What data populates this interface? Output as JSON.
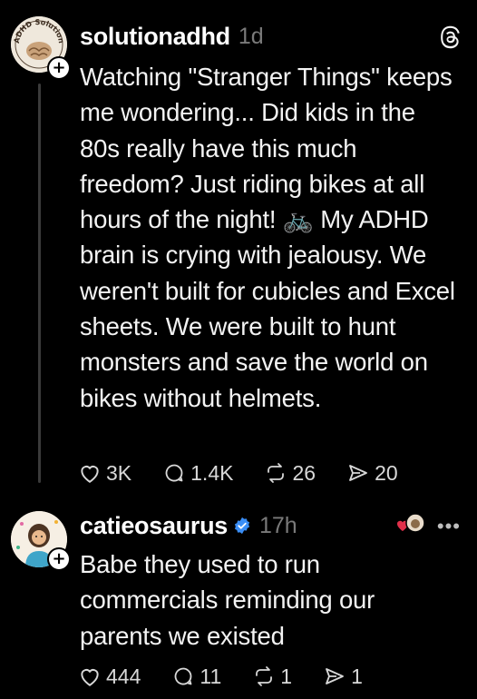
{
  "posts": [
    {
      "username": "solutionadhd",
      "time": "1d",
      "avatar_text": "ADHD Solution",
      "text": "Watching \"Stranger Things\" keeps me wondering... Did kids in the 80s really have this much freedom? Just riding bikes at all hours of the night! 🚲 My ADHD brain is crying with jealousy. We weren't built for cubicles and Excel sheets. We were built to hunt monsters and save the world on bikes without helmets.",
      "likes": "3K",
      "replies": "1.4K",
      "reposts": "26",
      "shares": "20",
      "platform_icon": "threads-icon"
    },
    {
      "username": "catieosaurus",
      "verified": true,
      "time": "17h",
      "text": "Babe they used to run commercials reminding our parents we existed",
      "likes": "444",
      "replies": "11",
      "reposts": "1",
      "shares": "1"
    }
  ],
  "colors": {
    "background": "#000000",
    "text": "#f3f3f3",
    "muted": "#7a7a7a",
    "verified": "#3a8ef6",
    "heart": "#e0304a"
  }
}
